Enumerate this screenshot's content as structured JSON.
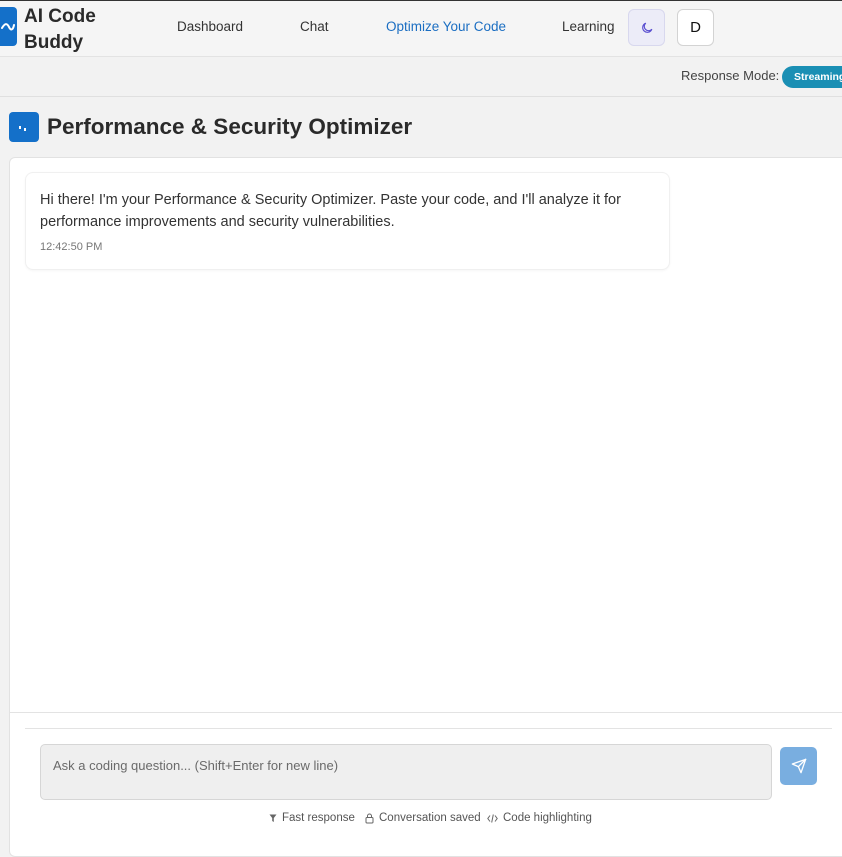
{
  "header": {
    "brand": "AI Code Buddy",
    "nav": [
      {
        "label": "Dashboard"
      },
      {
        "label": "Chat"
      },
      {
        "label": "Optimize Your Code",
        "active": true
      },
      {
        "label": "Learning"
      }
    ],
    "avatar_initial": "D",
    "theme_icon": "moon-icon",
    "logo_icon": "wave-icon"
  },
  "mode_bar": {
    "label": "Response Mode:",
    "value": "Streaming"
  },
  "page": {
    "title": "Performance & Security Optimizer",
    "title_icon": "chart-icon"
  },
  "messages": [
    {
      "text": "Hi there! I'm your Performance & Security Optimizer. Paste your code, and I'll analyze it for performance improvements and security vulnerabilities.",
      "time": "12:42:50 PM"
    }
  ],
  "composer": {
    "placeholder": "Ask a coding question... (Shift+Enter for new line)",
    "send_icon": "send-icon"
  },
  "features": [
    {
      "label": "Fast response",
      "icon": "filter-icon"
    },
    {
      "label": "Conversation saved",
      "icon": "lock-icon"
    },
    {
      "label": "Code highlighting",
      "icon": "code-icon"
    }
  ],
  "colors": {
    "accent": "#1470c9",
    "active_link": "#1b6ec2",
    "mode_pill": "#1a8fb4",
    "send_button": "#79aee0"
  }
}
